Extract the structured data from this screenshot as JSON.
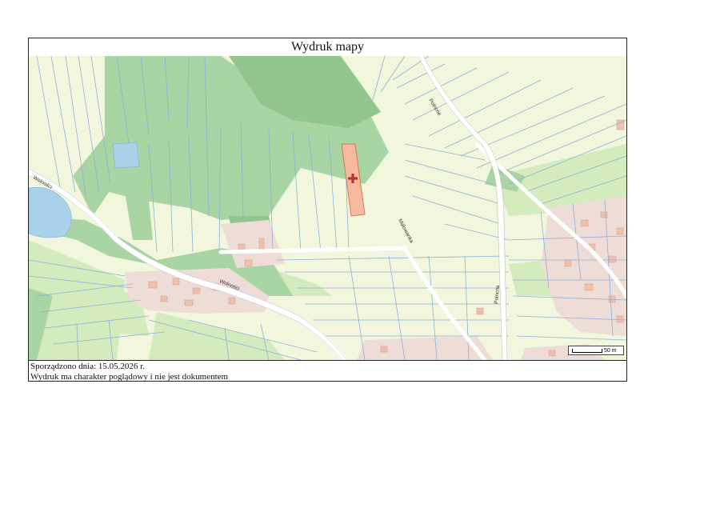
{
  "title": "Wydruk mapy",
  "footer": {
    "date_line": "Sporządzono dnia: 15.05.2026 r.",
    "disclaimer": "Wydruk ma charakter poglądowy i nie jest dokumentem"
  },
  "scale": {
    "label": "50 m"
  },
  "streets": {
    "wolnosci_a": "Wolności",
    "wolnosci_b": "Wolności",
    "polna": "Polncne",
    "malowanka": "Malowanka",
    "polna_b": "Polncna"
  },
  "colors": {
    "field": "#f1f6dc",
    "forest": "#a9d4a3",
    "forest_dark": "#93c58f",
    "meadow": "#d3ebbd",
    "water": "#a9d1ea",
    "built": "#eedcd6",
    "building": "#f0c0ad",
    "parcel_line": "#8fb1da",
    "road": "#ffffff",
    "highlight": "#f7b9a0",
    "marker": "#b5362a"
  },
  "marker_icon": "cross-icon"
}
